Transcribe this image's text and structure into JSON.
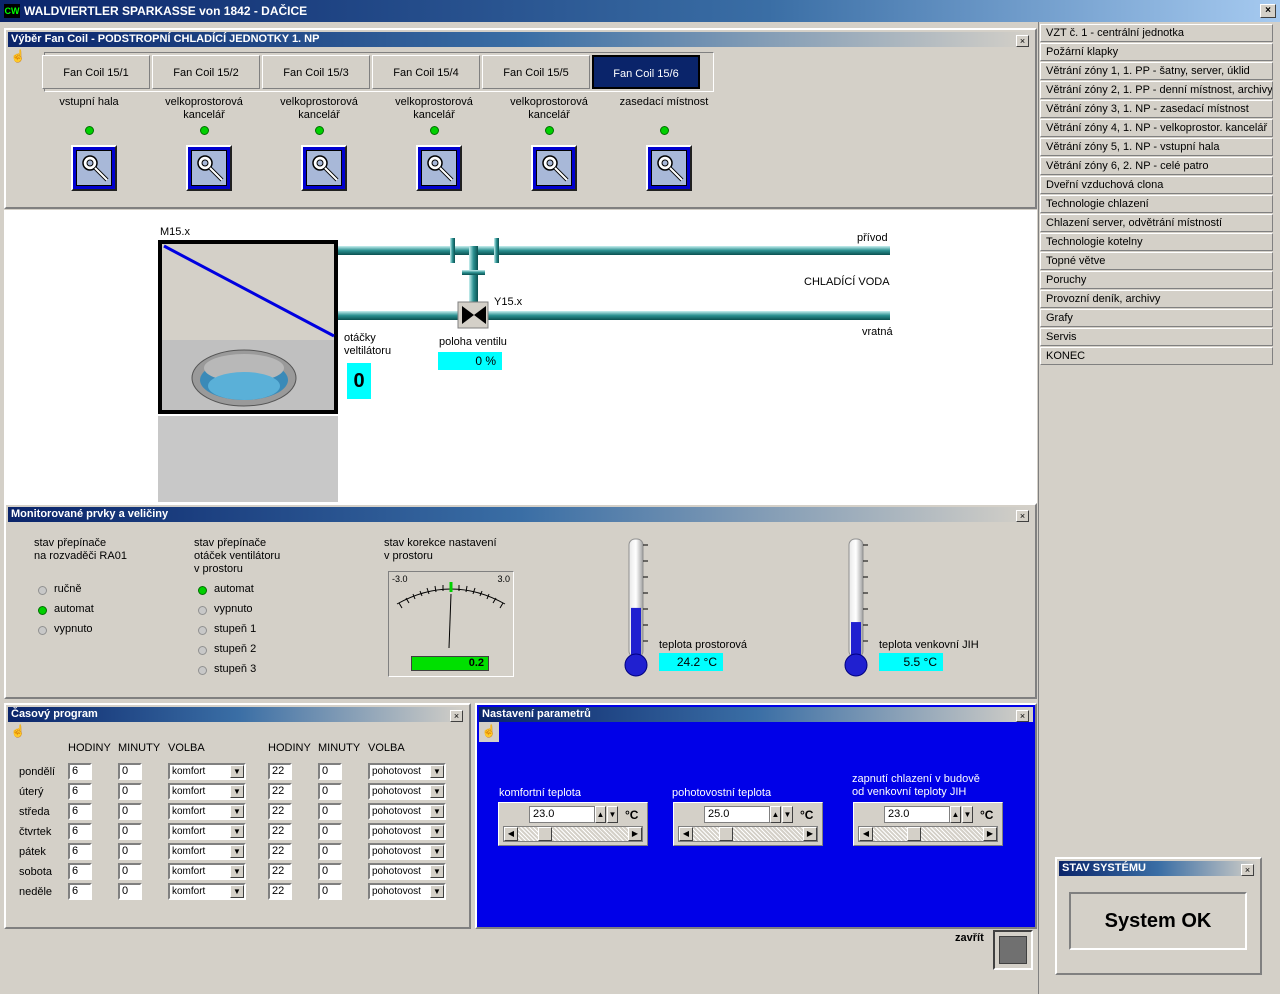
{
  "window": {
    "title": "WALDVIERTLER SPARKASSE von  1842 - DAČICE",
    "logo": "CW",
    "close": "×"
  },
  "fancoil_panel": {
    "title": "Výběr Fan Coil - PODSTROPNÍ CHLADÍCÍ JEDNOTKY 1. NP",
    "close": "×",
    "hand_icon": "☝",
    "tabs": [
      {
        "label": "Fan Coil 15/1",
        "room_line1": "vstupní hala",
        "room_line2": "",
        "led": "on"
      },
      {
        "label": "Fan Coil 15/2",
        "room_line1": "velkoprostorová",
        "room_line2": "kancelář",
        "led": "on"
      },
      {
        "label": "Fan Coil 15/3",
        "room_line1": "velkoprostorová",
        "room_line2": "kancelář",
        "led": "on"
      },
      {
        "label": "Fan Coil 15/4",
        "room_line1": "velkoprostorová",
        "room_line2": "kancelář",
        "led": "on"
      },
      {
        "label": "Fan Coil 15/5",
        "room_line1": "velkoprostorová",
        "room_line2": "kancelář",
        "led": "on"
      },
      {
        "label": "Fan Coil 15/6",
        "room_line1": "zasedací místnost",
        "room_line2": "",
        "led": "on"
      }
    ],
    "active_tab_index": 5
  },
  "diagram": {
    "motor_label": "M15.x",
    "valve_label": "Y15.x",
    "supply_label": "přívod",
    "water_label": "CHLADÍCÍ VODA",
    "return_label": "vratná",
    "fan_speed_label_line1": "otáčky",
    "fan_speed_label_line2": "veltilátoru",
    "fan_speed_value": "0",
    "valve_position_label": "poloha ventilu",
    "valve_position_value": "0 %"
  },
  "monitor_panel": {
    "title": "Monitorované prvky a veličiny",
    "close": "×",
    "switch_ra01_line1": "stav přepínače",
    "switch_ra01_line2": "na rozvaděči RA01",
    "switch_ra01_options": [
      {
        "label": "ručně",
        "led": "off"
      },
      {
        "label": "automat",
        "led": "on"
      },
      {
        "label": "vypnuto",
        "led": "off"
      }
    ],
    "fan_switch_line1": "stav přepínače",
    "fan_switch_line2": "otáček ventilátoru",
    "fan_switch_line3": "v prostoru",
    "fan_switch_options": [
      {
        "label": "automat",
        "led": "on"
      },
      {
        "label": "vypnuto",
        "led": "off"
      },
      {
        "label": "stupeň 1",
        "led": "off"
      },
      {
        "label": "stupeň 2",
        "led": "off"
      },
      {
        "label": "stupeň 3",
        "led": "off"
      }
    ],
    "correction_line1": "stav korekce nastavení",
    "correction_line2": "v prostoru",
    "gauge_min": "-3.0",
    "gauge_max": "3.0",
    "gauge_value": "0.2",
    "room_temp_label": "teplota prostorová",
    "room_temp_value": "24.2 °C",
    "room_temp_fill": 0.45,
    "outdoor_temp_label": "teplota venkovní JIH",
    "outdoor_temp_value": "5.5 °C",
    "outdoor_temp_fill": 0.33
  },
  "schedule_panel": {
    "title": "Časový program",
    "close": "×",
    "hand_icon": "☝",
    "headers": [
      "HODINY",
      "MINUTY",
      "VOLBA",
      "HODINY",
      "MINUTY",
      "VOLBA"
    ],
    "rows": [
      {
        "day": "pondělí",
        "h1": "6",
        "m1": "0",
        "v1": "komfort",
        "h2": "22",
        "m2": "0",
        "v2": "pohotovost"
      },
      {
        "day": "úterý",
        "h1": "6",
        "m1": "0",
        "v1": "komfort",
        "h2": "22",
        "m2": "0",
        "v2": "pohotovost"
      },
      {
        "day": "středa",
        "h1": "6",
        "m1": "0",
        "v1": "komfort",
        "h2": "22",
        "m2": "0",
        "v2": "pohotovost"
      },
      {
        "day": "čtvrtek",
        "h1": "6",
        "m1": "0",
        "v1": "komfort",
        "h2": "22",
        "m2": "0",
        "v2": "pohotovost"
      },
      {
        "day": "pátek",
        "h1": "6",
        "m1": "0",
        "v1": "komfort",
        "h2": "22",
        "m2": "0",
        "v2": "pohotovost"
      },
      {
        "day": "sobota",
        "h1": "6",
        "m1": "0",
        "v1": "komfort",
        "h2": "22",
        "m2": "0",
        "v2": "pohotovost"
      },
      {
        "day": "neděle",
        "h1": "6",
        "m1": "0",
        "v1": "komfort",
        "h2": "22",
        "m2": "0",
        "v2": "pohotovost"
      }
    ]
  },
  "params_panel": {
    "title": "Nastavení parametrů",
    "close": "×",
    "hand_icon": "☝",
    "comfort_label": "komfortní teplota",
    "comfort_value": "23.0",
    "standby_label": "pohotovostní teplota",
    "standby_value": "25.0",
    "cooling_label_line1": "zapnutí chlazení v budově",
    "cooling_label_line2": "od venkovní teploty JIH",
    "cooling_value": "23.0",
    "unit": "°C"
  },
  "menu": {
    "items": [
      "VZT č. 1 - centrální jednotka",
      "Požární klapky",
      "Větrání zóny 1, 1. PP - šatny, server, úklid",
      "Větrání zóny 2, 1. PP - denní místnost, archivy",
      "Větrání zóny 3, 1. NP - zasedací místnost",
      "Větrání zóny 4, 1. NP - velkoprostor. kancelář",
      "Větrání zóny 5, 1. NP - vstupní hala",
      "Větrání zóny 6, 2. NP - celé patro",
      "Dveřní vzduchová clona",
      "Technologie chlazení",
      "Chlazení server, odvětrání místností",
      "Technologie kotelny",
      "Topné větve",
      "Poruchy",
      "Provozní deník, archivy",
      "Grafy",
      "Servis",
      "KONEC"
    ]
  },
  "status_panel": {
    "title": "STAV SYSTÉMU",
    "close": "×",
    "value": "System OK"
  },
  "close_button": {
    "label": "zavřít"
  },
  "colors": {
    "accent": "#0a246a",
    "led_on": "#00d000",
    "cyan": "#00ffff",
    "params_bg": "#0000e8"
  }
}
